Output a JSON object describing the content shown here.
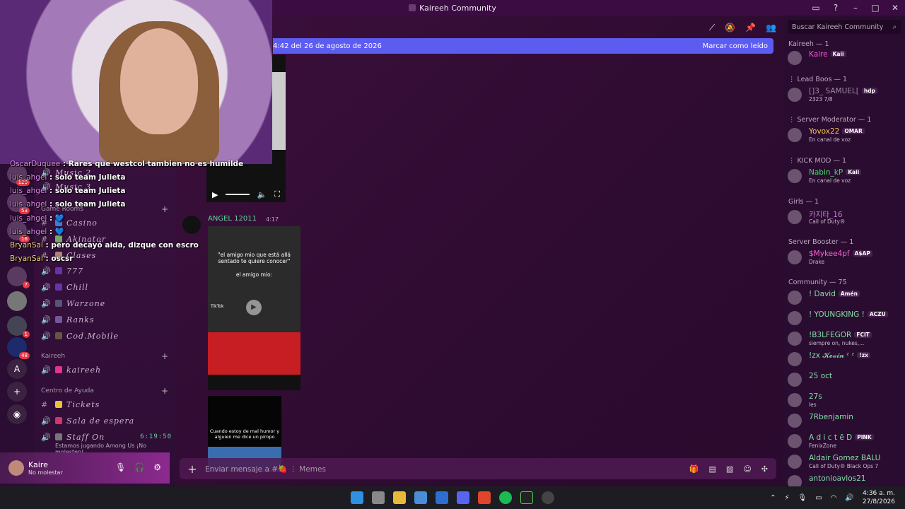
{
  "window": {
    "title": "Kaireeh Community"
  },
  "chat_overlay": [
    {
      "user": "OscarDuquee",
      "text": ": Rares que westcol tambien no es humilde"
    },
    {
      "user": "luis_ahgel",
      "text": ": solo team Julieta"
    },
    {
      "user": "luis_ahgel",
      "text": ": solo team Julieta"
    },
    {
      "user": "luis_ahgel",
      "text": ": solo team Julieta"
    },
    {
      "user": "luis_ahgel",
      "text": ": 💙"
    },
    {
      "user": "luis_ahgel",
      "text": ": 💙"
    },
    {
      "user": "BryanSal",
      "text": ": pero decayó aida, dizque con escro"
    },
    {
      "user": "BryanSal",
      "text": ": oscsr"
    }
  ],
  "rail": {
    "badges": [
      "120",
      "53",
      "16",
      "7",
      "1",
      "48"
    ],
    "letter": "A"
  },
  "channels": {
    "items_top": [
      "Music 2",
      "Music 3"
    ],
    "categories": [
      {
        "name": "Game Rooms",
        "items": [
          "Casino",
          "Akinator",
          "Clases",
          "777",
          "Chill",
          "Warzone",
          "Ranks",
          "Cod.Mobile"
        ]
      },
      {
        "name": "Kaireeh",
        "items": [
          "kaireeh"
        ]
      },
      {
        "name": "Centro de Ayuda",
        "items": [
          "Tickets",
          "Sala de espera",
          "Staff On"
        ]
      }
    ],
    "staff_time": "6:19:50",
    "staff_sub": "Estamos jugando Among Us ¡No molesten!"
  },
  "user_panel": {
    "name": "Kaire",
    "status": "No molestar"
  },
  "main": {
    "banner_text": "4:42 del 26 de agosto de 2026",
    "banner_action": "Marcar como leído",
    "message": {
      "author": "ANGEL 12011",
      "time": "4:17"
    },
    "video1": {
      "caption": "\"el amigo mio que está allá sentado te quiere conocer\"",
      "caption2": "el amigo mio:",
      "tiktok": "TikTok"
    },
    "video2": {
      "caption": "Cuando estoy de mal humor y alguien me dice un piropo"
    },
    "composer_placeholder": "Enviar mensaje a #🍓 ⋮ Memes"
  },
  "members": {
    "search_placeholder": "Buscar Kaireeh Community",
    "groups": [
      {
        "title": "Kaireeh — 1",
        "members": [
          {
            "name": "Kaire",
            "tag": "Kaii",
            "sub": "",
            "color": "#ff4fd8"
          }
        ]
      },
      {
        "title": "⋮ Lead Boos — 1",
        "members": [
          {
            "name": "[]3_ SAMUEL[",
            "tag": "hdp",
            "sub": "2323 7/8",
            "color": "#9c8aa0"
          }
        ]
      },
      {
        "title": "⋮ Server Moderator — 1",
        "members": [
          {
            "name": "Yovox22",
            "tag": "OMAR",
            "sub": "En canal de voz",
            "color": "#f2c14e"
          }
        ]
      },
      {
        "title": "⋮ KICK MOD — 1",
        "members": [
          {
            "name": "Nabin_kP",
            "tag": "Kaii",
            "sub": "En canal de voz",
            "color": "#3ddc6a"
          }
        ]
      },
      {
        "title": "Girls — 1",
        "members": [
          {
            "name": "카지타_16",
            "tag": "",
            "sub": "Call of Duty®",
            "color": "#c27bd1"
          }
        ]
      },
      {
        "title": "Server Booster — 1",
        "members": [
          {
            "name": "$Mykee4pf",
            "tag": "A$AP",
            "sub": "Drake",
            "color": "#ff5fd2"
          }
        ]
      },
      {
        "title": "Community — 75",
        "members": [
          {
            "name": "! David",
            "tag": "Amén",
            "sub": "",
            "color": "#7ee0a0"
          },
          {
            "name": "! YOUNGKING !",
            "tag": "ACZU",
            "sub": "",
            "color": "#7ee0a0"
          },
          {
            "name": "!B3LFEGOR",
            "tag": "FCIT",
            "sub": "siempre on, nukes,...",
            "color": "#7ee0a0"
          },
          {
            "name": "!zx 𝓚𝓮𝓿𝓲𝓷 ᶻ ᶻ",
            "tag": "!zx",
            "sub": "",
            "color": "#7ee0a0"
          },
          {
            "name": "25 oct",
            "tag": "",
            "sub": "",
            "color": "#7ee0a0"
          },
          {
            "name": "27s",
            "tag": "",
            "sub": "les",
            "color": "#7ee0a0"
          },
          {
            "name": "7Rbenjamin",
            "tag": "",
            "sub": "",
            "color": "#7ee0a0"
          },
          {
            "name": "A d i c t ē D",
            "tag": "PINK",
            "sub": "FenixZone",
            "color": "#7ee0a0"
          },
          {
            "name": "Aldair Gomez BALU",
            "tag": "",
            "sub": "Call of Duty® Black Ops 7",
            "color": "#7ee0a0"
          },
          {
            "name": "antonioavlos21",
            "tag": "",
            "sub": "",
            "color": "#7ee0a0"
          }
        ]
      }
    ]
  },
  "taskbar": {
    "time": "4:36 a. m.",
    "date": "27/8/2026"
  }
}
